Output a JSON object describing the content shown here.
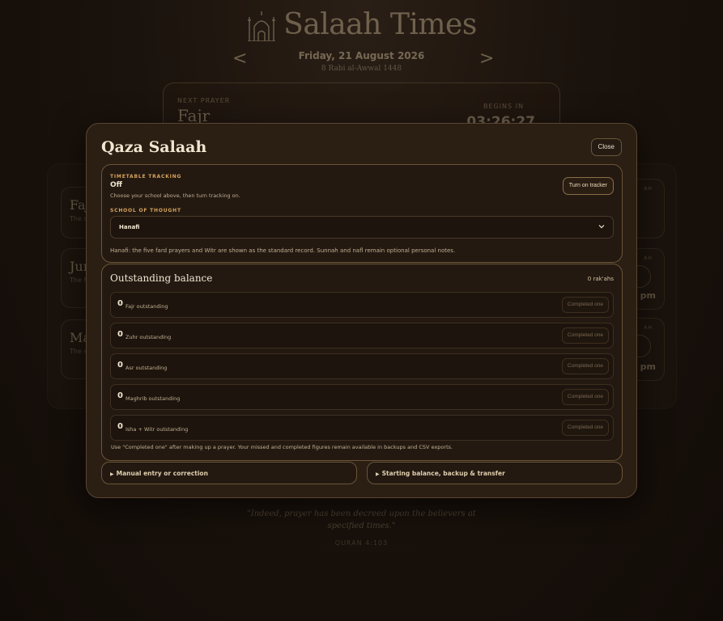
{
  "app": {
    "title": "Salaah Times",
    "date": "Friday, 21 August 2026",
    "hijri": "8 Rabi al-Awwal 1448",
    "prev_icon": "<",
    "next_icon": ">"
  },
  "next_prayer": {
    "label": "NEXT PRAYER",
    "name": "Fajr",
    "begins_label": "BEGINS IN",
    "countdown": "03:26:27"
  },
  "background_cards": [
    {
      "name": "Fajr",
      "sub": "The d"
    },
    {
      "name": "Jum",
      "sub": "The F"
    },
    {
      "name": "Ma",
      "sub": "The s"
    }
  ],
  "background_right": [
    {
      "label": "AH",
      "time": ""
    },
    {
      "label": "AH",
      "time": "pm"
    },
    {
      "label": "AH",
      "time": "pm"
    }
  ],
  "quote": {
    "text": "\"Indeed, prayer has been decreed upon the believers at specified times.\"",
    "ref": "QURAN 4:103"
  },
  "modal": {
    "title": "Qaza Salaah",
    "close_label": "Close",
    "tracking": {
      "label": "TIMETABLE TRACKING",
      "value": "Off",
      "help": "Choose your school above, then turn tracking on.",
      "button": "Turn on tracker"
    },
    "school": {
      "label": "SCHOOL OF THOUGHT",
      "selected": "Hanafi",
      "note": "Hanafi: the five fard prayers and Witr are shown as the standard record. Sunnah and nafl remain optional personal notes."
    },
    "balance": {
      "title": "Outstanding balance",
      "total": "0 rak'ahs",
      "rows": [
        {
          "count": "0",
          "label": "Fajr outstanding",
          "button": "Completed one"
        },
        {
          "count": "0",
          "label": "Zuhr outstanding",
          "button": "Completed one"
        },
        {
          "count": "0",
          "label": "Asr outstanding",
          "button": "Completed one"
        },
        {
          "count": "0",
          "label": "Maghrib outstanding",
          "button": "Completed one"
        },
        {
          "count": "0",
          "label": "Isha + Witr outstanding",
          "button": "Completed one"
        }
      ],
      "footer": "Use \"Completed one\" after making up a prayer. Your missed and completed figures remain available in backups and CSV exports."
    },
    "sections": {
      "manual": "Manual entry or correction",
      "starting": "Starting balance, backup & transfer"
    }
  },
  "colors": {
    "accent": "#d6a35c",
    "modal_bg": "#2b1f14",
    "border": "#6a5538"
  }
}
